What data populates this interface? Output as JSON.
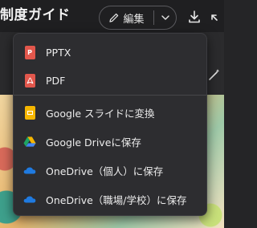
{
  "header": {
    "title": "制度ガイド",
    "edit_label": "編集"
  },
  "menu": {
    "items": [
      {
        "label": "PPTX",
        "icon": "pptx-file-icon",
        "color": "#e2574c"
      },
      {
        "label": "PDF",
        "icon": "pdf-file-icon",
        "color": "#e2574c"
      },
      {
        "label": "Google スライドに変換",
        "icon": "google-slides-icon",
        "color": "#f6b600"
      },
      {
        "label": "Google Driveに保存",
        "icon": "google-drive-icon",
        "color": "#1fa463"
      },
      {
        "label": "OneDrive（個人）に保存",
        "icon": "onedrive-icon",
        "color": "#1f7ae0"
      },
      {
        "label": "OneDrive（職場/学校）に保存",
        "icon": "onedrive-icon",
        "color": "#1f7ae0"
      }
    ]
  },
  "colors": {
    "background": "#252527",
    "menu_background": "#2d2d30",
    "text": "#ececec"
  }
}
